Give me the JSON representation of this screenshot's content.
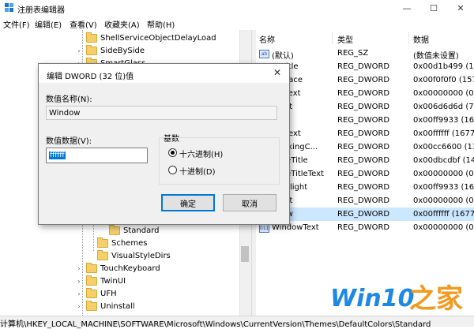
{
  "window": {
    "title": "注册表编辑器",
    "minimize_glyph": "—",
    "maximize_glyph": "☐",
    "close_glyph": "✕"
  },
  "menu": {
    "items": [
      {
        "label": "文件(F)"
      },
      {
        "label": "编辑(E)"
      },
      {
        "label": "查看(V)"
      },
      {
        "label": "收藏夹(A)"
      },
      {
        "label": "帮助(H)"
      }
    ]
  },
  "tree": {
    "items": [
      {
        "label": "ShellServiceObjectDelayLoad",
        "expander": "",
        "depth": 1
      },
      {
        "label": "SideBySide",
        "expander": "›",
        "depth": 1
      },
      {
        "label": "SmartGlass",
        "expander": "›",
        "depth": 1
      },
      {
        "label": "Standard",
        "expander": "",
        "depth": 3,
        "selected": true
      },
      {
        "label": "Schemes",
        "expander": "",
        "depth": 2
      },
      {
        "label": "VisualStyleDirs",
        "expander": "",
        "depth": 2
      },
      {
        "label": "TouchKeyboard",
        "expander": "›",
        "depth": 1
      },
      {
        "label": "TwinUI",
        "expander": "›",
        "depth": 1
      },
      {
        "label": "UFH",
        "expander": "›",
        "depth": 1
      },
      {
        "label": "Uninstall",
        "expander": "›",
        "depth": 1
      }
    ]
  },
  "list": {
    "headers": {
      "name": "名称",
      "type": "类型",
      "data": "数据"
    },
    "rows": [
      {
        "name": "(默认)",
        "type": "REG_SZ",
        "data": "(数值未设置)",
        "icon": "ab"
      },
      {
        "name": "veTitle",
        "type": "REG_DWORD",
        "data": "0x00d1b499 (13"
      },
      {
        "name": "tonFace",
        "type": "REG_DWORD",
        "data": "0x00f0f0f0 (1579"
      },
      {
        "name": "tonText",
        "type": "REG_DWORD",
        "data": "0x00000000 (0)"
      },
      {
        "name": "yText",
        "type": "REG_DWORD",
        "data": "0x006d6d6d (71"
      },
      {
        "name": "ght",
        "type": "REG_DWORD",
        "data": "0x00ff9933 (1675"
      },
      {
        "name": "ghtText",
        "type": "REG_DWORD",
        "data": "0x00ffffff (16777"
      },
      {
        "name": "TrackingC...",
        "type": "REG_DWORD",
        "data": "0x00cc6600 (133"
      },
      {
        "name": "ctiveTitle",
        "type": "REG_DWORD",
        "data": "0x00dbcdbf (144"
      },
      {
        "name": "ctiveTitleText",
        "type": "REG_DWORD",
        "data": "0x00000000 (0)"
      },
      {
        "name": "nuHilight",
        "type": "REG_DWORD",
        "data": "0x00ff9933 (1675"
      },
      {
        "name": "eText",
        "type": "REG_DWORD",
        "data": "0x00000000 (0)"
      },
      {
        "name": "ndow",
        "type": "REG_DWORD",
        "data": "0x00ffffff (16777",
        "selected": true
      },
      {
        "name": "WindowText",
        "type": "REG_DWORD",
        "data": "0x00000000 (0)",
        "icon": "011"
      }
    ]
  },
  "dialog": {
    "title": "编辑 DWORD (32 位)值",
    "name_label": "数值名称(N):",
    "name_value": "Window",
    "data_label": "数值数据(V):",
    "data_value": "ffffff",
    "base_label": "基数",
    "hex_label": "十六进制(H)",
    "dec_label": "十进制(D)",
    "hex_selected": true,
    "ok_label": "确定",
    "cancel_label": "取消"
  },
  "status": {
    "path": "计算机\\HKEY_LOCAL_MACHINE\\SOFTWARE\\Microsoft\\Windows\\CurrentVersion\\Themes\\DefaultColors\\Standard"
  },
  "watermark": {
    "text": "Win10之家",
    "colors": {
      "blue": "#1e88e5",
      "orange": "#f29a1e"
    }
  },
  "colors": {
    "accent": "#0078d7",
    "selection": "#cce8ff",
    "folder": "#f4cf6b"
  }
}
